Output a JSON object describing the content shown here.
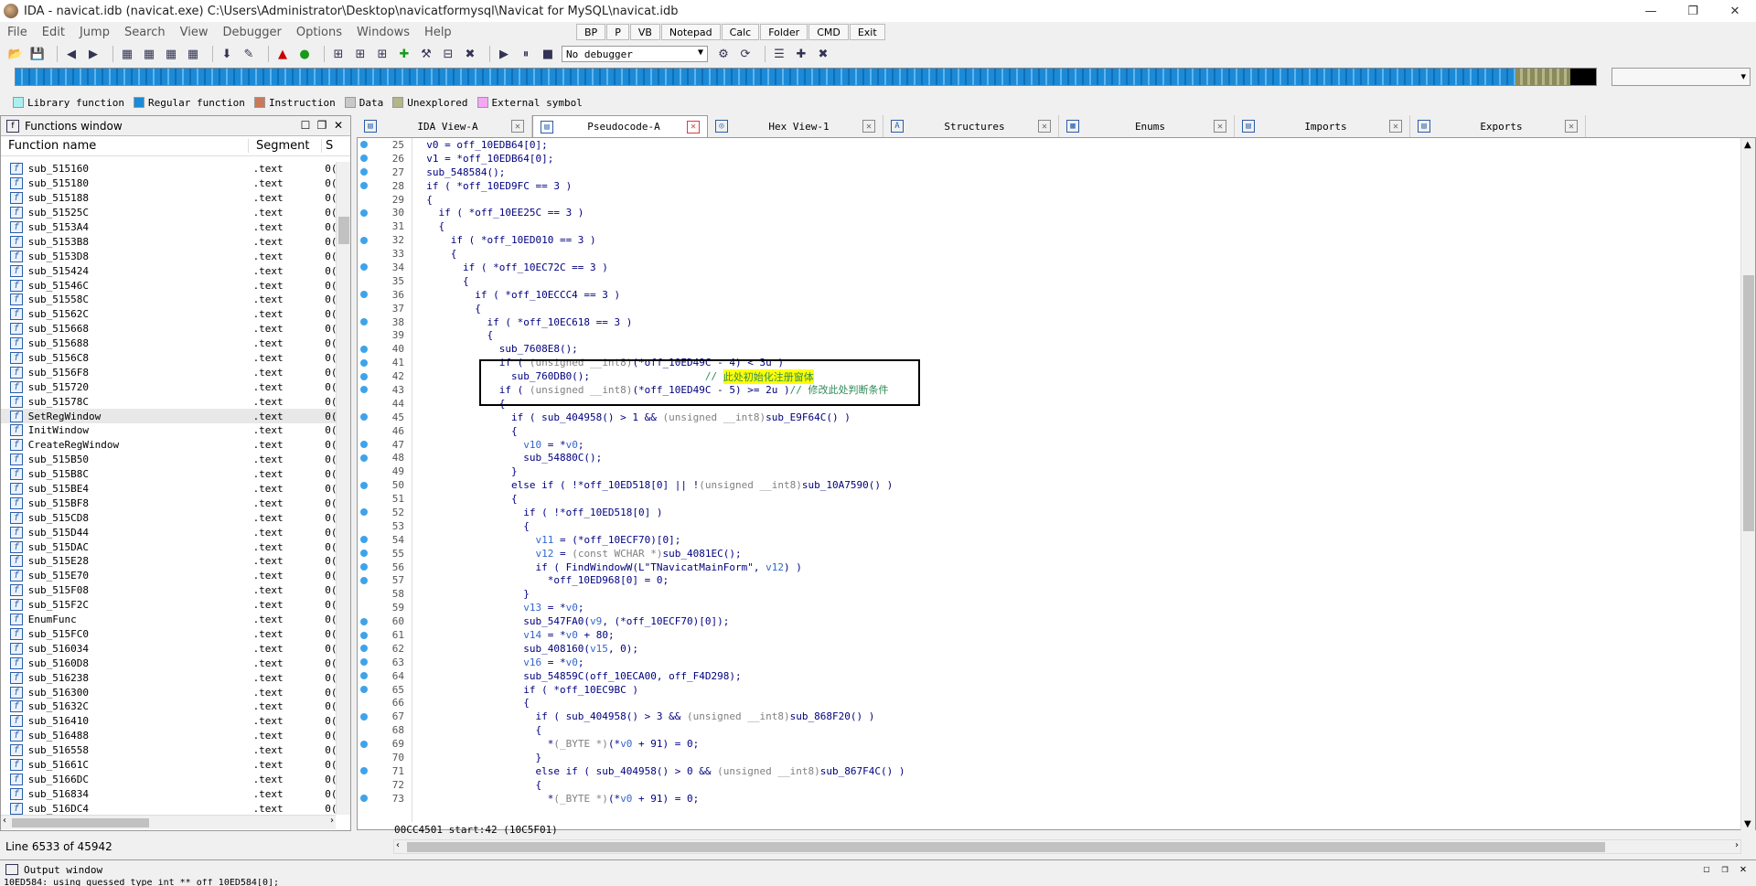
{
  "titlebar": {
    "title": "IDA - navicat.idb (navicat.exe) C:\\Users\\Administrator\\Desktop\\navicatformysql\\Navicat for MySQL\\navicat.idb",
    "minimize": "—",
    "restore": "❐",
    "close": "✕"
  },
  "menubar": {
    "items": [
      "File",
      "Edit",
      "Jump",
      "Search",
      "View",
      "Debugger",
      "Options",
      "Windows",
      "Help"
    ]
  },
  "quickbar": {
    "items": [
      "BP",
      "P",
      "VB",
      "Notepad",
      "Calc",
      "Folder",
      "CMD",
      "Exit"
    ]
  },
  "toolbar": {
    "debugger_select": "No debugger"
  },
  "legend": {
    "items": [
      {
        "label": "Library function",
        "color": "#aaf0f0"
      },
      {
        "label": "Regular function",
        "color": "#1c8ad6"
      },
      {
        "label": "Instruction",
        "color": "#c87a5a"
      },
      {
        "label": "Data",
        "color": "#c8c8c8"
      },
      {
        "label": "Unexplored",
        "color": "#b5b58a"
      },
      {
        "label": "External symbol",
        "color": "#f5a6f5"
      }
    ]
  },
  "functions_window": {
    "title": "Functions window",
    "col_name": "Function name",
    "col_segment": "Segment",
    "col_start": "S",
    "icon_letter": "f",
    "rows": [
      {
        "name": "sub_515160",
        "seg": ".text",
        "s": "0("
      },
      {
        "name": "sub_515180",
        "seg": ".text",
        "s": "0("
      },
      {
        "name": "sub_515188",
        "seg": ".text",
        "s": "0("
      },
      {
        "name": "sub_51525C",
        "seg": ".text",
        "s": "0("
      },
      {
        "name": "sub_5153A4",
        "seg": ".text",
        "s": "0("
      },
      {
        "name": "sub_5153B8",
        "seg": ".text",
        "s": "0("
      },
      {
        "name": "sub_5153D8",
        "seg": ".text",
        "s": "0("
      },
      {
        "name": "sub_515424",
        "seg": ".text",
        "s": "0("
      },
      {
        "name": "sub_51546C",
        "seg": ".text",
        "s": "0("
      },
      {
        "name": "sub_51558C",
        "seg": ".text",
        "s": "0("
      },
      {
        "name": "sub_51562C",
        "seg": ".text",
        "s": "0("
      },
      {
        "name": "sub_515668",
        "seg": ".text",
        "s": "0("
      },
      {
        "name": "sub_515688",
        "seg": ".text",
        "s": "0("
      },
      {
        "name": "sub_5156C8",
        "seg": ".text",
        "s": "0("
      },
      {
        "name": "sub_5156F8",
        "seg": ".text",
        "s": "0("
      },
      {
        "name": "sub_515720",
        "seg": ".text",
        "s": "0("
      },
      {
        "name": "sub_51578C",
        "seg": ".text",
        "s": "0("
      },
      {
        "name": "SetRegWindow",
        "seg": ".text",
        "s": "0("
      },
      {
        "name": "InitWindow",
        "seg": ".text",
        "s": "0("
      },
      {
        "name": "CreateRegWindow",
        "seg": ".text",
        "s": "0("
      },
      {
        "name": "sub_515B50",
        "seg": ".text",
        "s": "0("
      },
      {
        "name": "sub_515B8C",
        "seg": ".text",
        "s": "0("
      },
      {
        "name": "sub_515BE4",
        "seg": ".text",
        "s": "0("
      },
      {
        "name": "sub_515BF8",
        "seg": ".text",
        "s": "0("
      },
      {
        "name": "sub_515CD8",
        "seg": ".text",
        "s": "0("
      },
      {
        "name": "sub_515D44",
        "seg": ".text",
        "s": "0("
      },
      {
        "name": "sub_515DAC",
        "seg": ".text",
        "s": "0("
      },
      {
        "name": "sub_515E28",
        "seg": ".text",
        "s": "0("
      },
      {
        "name": "sub_515E70",
        "seg": ".text",
        "s": "0("
      },
      {
        "name": "sub_515F08",
        "seg": ".text",
        "s": "0("
      },
      {
        "name": "sub_515F2C",
        "seg": ".text",
        "s": "0("
      },
      {
        "name": "EnumFunc",
        "seg": ".text",
        "s": "0("
      },
      {
        "name": "sub_515FC0",
        "seg": ".text",
        "s": "0("
      },
      {
        "name": "sub_516034",
        "seg": ".text",
        "s": "0("
      },
      {
        "name": "sub_5160D8",
        "seg": ".text",
        "s": "0("
      },
      {
        "name": "sub_516238",
        "seg": ".text",
        "s": "0("
      },
      {
        "name": "sub_516300",
        "seg": ".text",
        "s": "0("
      },
      {
        "name": "sub_51632C",
        "seg": ".text",
        "s": "0("
      },
      {
        "name": "sub_516410",
        "seg": ".text",
        "s": "0("
      },
      {
        "name": "sub_516488",
        "seg": ".text",
        "s": "0("
      },
      {
        "name": "sub_516558",
        "seg": ".text",
        "s": "0("
      },
      {
        "name": "sub_51661C",
        "seg": ".text",
        "s": "0("
      },
      {
        "name": "sub_5166DC",
        "seg": ".text",
        "s": "0("
      },
      {
        "name": "sub_516834",
        "seg": ".text",
        "s": "0("
      },
      {
        "name": "sub_516DC4",
        "seg": ".text",
        "s": "0("
      }
    ],
    "status": "Line 6533 of 45942"
  },
  "tabs": [
    {
      "label": "IDA View-A",
      "icon": "▤"
    },
    {
      "label": "Pseudocode-A",
      "icon": "▤"
    },
    {
      "label": "Hex View-1",
      "icon": "◎"
    },
    {
      "label": "Structures",
      "icon": "A"
    },
    {
      "label": "Enums",
      "icon": "▦"
    },
    {
      "label": "Imports",
      "icon": "▤"
    },
    {
      "label": "Exports",
      "icon": "▤"
    }
  ],
  "code": {
    "dot_lines": [
      25,
      26,
      27,
      28,
      30,
      32,
      34,
      36,
      38,
      40,
      41,
      42,
      43,
      45,
      47,
      48,
      50,
      52,
      54,
      55,
      56,
      57,
      60,
      61,
      62,
      63,
      64,
      65,
      67,
      69,
      71,
      73
    ],
    "lines": [
      {
        "n": "25",
        "parts": [
          [
            "  v0 = off_10EDB64[0];",
            ""
          ]
        ]
      },
      {
        "n": "26",
        "parts": [
          [
            "  v1 = *off_10EDB64[0];",
            ""
          ]
        ]
      },
      {
        "n": "27",
        "parts": [
          [
            "  sub_548584();",
            ""
          ]
        ]
      },
      {
        "n": "28",
        "parts": [
          [
            "  if ( *off_10ED9FC == 3 )",
            ""
          ]
        ]
      },
      {
        "n": "29",
        "parts": [
          [
            "  {",
            ""
          ]
        ]
      },
      {
        "n": "30",
        "parts": [
          [
            "    if ( *off_10EE25C == 3 )",
            ""
          ]
        ]
      },
      {
        "n": "31",
        "parts": [
          [
            "    {",
            ""
          ]
        ]
      },
      {
        "n": "32",
        "parts": [
          [
            "      if ( *off_10ED010 == 3 )",
            ""
          ]
        ]
      },
      {
        "n": "33",
        "parts": [
          [
            "      {",
            ""
          ]
        ]
      },
      {
        "n": "34",
        "parts": [
          [
            "        if ( *off_10EC72C == 3 )",
            ""
          ]
        ]
      },
      {
        "n": "35",
        "parts": [
          [
            "        {",
            ""
          ]
        ]
      },
      {
        "n": "36",
        "parts": [
          [
            "          if ( *off_10ECCC4 == 3 )",
            ""
          ]
        ]
      },
      {
        "n": "37",
        "parts": [
          [
            "          {",
            ""
          ]
        ]
      },
      {
        "n": "38",
        "parts": [
          [
            "            if ( *off_10EC618 == 3 )",
            ""
          ]
        ]
      },
      {
        "n": "39",
        "parts": [
          [
            "            {",
            ""
          ]
        ]
      },
      {
        "n": "40",
        "parts": [
          [
            "              sub_7608E8();",
            ""
          ]
        ]
      },
      {
        "n": "41",
        "parts": [
          [
            "              if ( ",
            ""
          ],
          [
            "(unsigned __int8)",
            "gray"
          ],
          [
            "(*off_10ED49C - 4) < 3u )",
            ""
          ]
        ]
      },
      {
        "n": "42",
        "parts": [
          [
            "                sub_760DB0();                   ",
            ""
          ],
          [
            "// ",
            "cmt"
          ],
          [
            "此处初始化注册窗体",
            "hl"
          ]
        ]
      },
      {
        "n": "43",
        "parts": [
          [
            "              if ( ",
            ""
          ],
          [
            "(unsigned __int8)",
            "gray"
          ],
          [
            "(*off_10ED49C - 5) >= 2u )",
            ""
          ],
          [
            "// 修改此处判断条件",
            "cmt"
          ]
        ]
      },
      {
        "n": "44",
        "parts": [
          [
            "              {",
            ""
          ]
        ]
      },
      {
        "n": "45",
        "parts": [
          [
            "                if ( sub_404958() > 1 && ",
            ""
          ],
          [
            "(unsigned __int8)",
            "gray"
          ],
          [
            "sub_E9F64C() )",
            ""
          ]
        ]
      },
      {
        "n": "46",
        "parts": [
          [
            "                {",
            ""
          ]
        ]
      },
      {
        "n": "47",
        "parts": [
          [
            "                  ",
            ""
          ],
          [
            "v10",
            "vname"
          ],
          [
            " = *",
            ""
          ],
          [
            "v0",
            "vname"
          ],
          [
            ";",
            ""
          ]
        ]
      },
      {
        "n": "48",
        "parts": [
          [
            "                  sub_54880C();",
            ""
          ]
        ]
      },
      {
        "n": "49",
        "parts": [
          [
            "                }",
            ""
          ]
        ]
      },
      {
        "n": "50",
        "parts": [
          [
            "                else if ( !*off_10ED518[0] || !",
            ""
          ],
          [
            "(unsigned __int8)",
            "gray"
          ],
          [
            "sub_10A7590() )",
            ""
          ]
        ]
      },
      {
        "n": "51",
        "parts": [
          [
            "                {",
            ""
          ]
        ]
      },
      {
        "n": "52",
        "parts": [
          [
            "                  if ( !*off_10ED518[0] )",
            ""
          ]
        ]
      },
      {
        "n": "53",
        "parts": [
          [
            "                  {",
            ""
          ]
        ]
      },
      {
        "n": "54",
        "parts": [
          [
            "                    ",
            ""
          ],
          [
            "v11",
            "vname"
          ],
          [
            " = (*off_10ECF70)[0];",
            ""
          ]
        ]
      },
      {
        "n": "55",
        "parts": [
          [
            "                    ",
            ""
          ],
          [
            "v12",
            "vname"
          ],
          [
            " = ",
            ""
          ],
          [
            "(const WCHAR *)",
            "gray"
          ],
          [
            "sub_4081EC();",
            ""
          ]
        ]
      },
      {
        "n": "56",
        "parts": [
          [
            "                    if ( FindWindowW(L\"TNavicatMainForm\", ",
            ""
          ],
          [
            "v12",
            "vname"
          ],
          [
            ") )",
            ""
          ]
        ]
      },
      {
        "n": "57",
        "parts": [
          [
            "                      *off_10ED968[0] = 0;",
            ""
          ]
        ]
      },
      {
        "n": "58",
        "parts": [
          [
            "                  }",
            ""
          ]
        ]
      },
      {
        "n": "59",
        "parts": [
          [
            "                  ",
            ""
          ],
          [
            "v13",
            "vname"
          ],
          [
            " = *",
            ""
          ],
          [
            "v0",
            "vname"
          ],
          [
            ";",
            ""
          ]
        ]
      },
      {
        "n": "60",
        "parts": [
          [
            "                  sub_547FA0(",
            ""
          ],
          [
            "v9",
            "vname"
          ],
          [
            ", (*off_10ECF70)[0]);",
            ""
          ]
        ]
      },
      {
        "n": "61",
        "parts": [
          [
            "                  ",
            ""
          ],
          [
            "v14",
            "vname"
          ],
          [
            " = *",
            ""
          ],
          [
            "v0",
            "vname"
          ],
          [
            " + 80;",
            ""
          ]
        ]
      },
      {
        "n": "62",
        "parts": [
          [
            "                  sub_408160(",
            ""
          ],
          [
            "v15",
            "vname"
          ],
          [
            ", 0);",
            ""
          ]
        ]
      },
      {
        "n": "63",
        "parts": [
          [
            "                  ",
            ""
          ],
          [
            "v16",
            "vname"
          ],
          [
            " = *",
            ""
          ],
          [
            "v0",
            "vname"
          ],
          [
            ";",
            ""
          ]
        ]
      },
      {
        "n": "64",
        "parts": [
          [
            "                  sub_54859C(off_10ECA00, off_F4D298);",
            ""
          ]
        ]
      },
      {
        "n": "65",
        "parts": [
          [
            "                  if ( *off_10EC9BC )",
            ""
          ]
        ]
      },
      {
        "n": "66",
        "parts": [
          [
            "                  {",
            ""
          ]
        ]
      },
      {
        "n": "67",
        "parts": [
          [
            "                    if ( sub_404958() > 3 && ",
            ""
          ],
          [
            "(unsigned __int8)",
            "gray"
          ],
          [
            "sub_868F20() )",
            ""
          ]
        ]
      },
      {
        "n": "68",
        "parts": [
          [
            "                    {",
            ""
          ]
        ]
      },
      {
        "n": "69",
        "parts": [
          [
            "                      *",
            ""
          ],
          [
            "(_BYTE *)",
            "gray"
          ],
          [
            "(*",
            ""
          ],
          [
            "v0",
            "vname"
          ],
          [
            " + 91) = 0;",
            ""
          ]
        ]
      },
      {
        "n": "70",
        "parts": [
          [
            "                    }",
            ""
          ]
        ]
      },
      {
        "n": "71",
        "parts": [
          [
            "                    else if ( sub_404958() > 0 && ",
            ""
          ],
          [
            "(unsigned __int8)",
            "gray"
          ],
          [
            "sub_867F4C() )",
            ""
          ]
        ]
      },
      {
        "n": "72",
        "parts": [
          [
            "                    {",
            ""
          ]
        ]
      },
      {
        "n": "73",
        "parts": [
          [
            "                      *",
            ""
          ],
          [
            "(_BYTE *)",
            "gray"
          ],
          [
            "(*",
            ""
          ],
          [
            "v0",
            "vname"
          ],
          [
            " + 91) = 0;",
            ""
          ]
        ]
      }
    ],
    "status": "00CC4501 start:42 (10C5F01)"
  },
  "output_window": {
    "title": "Output window",
    "text": "10ED584: using guessed type int ** off_10ED584[0];"
  }
}
